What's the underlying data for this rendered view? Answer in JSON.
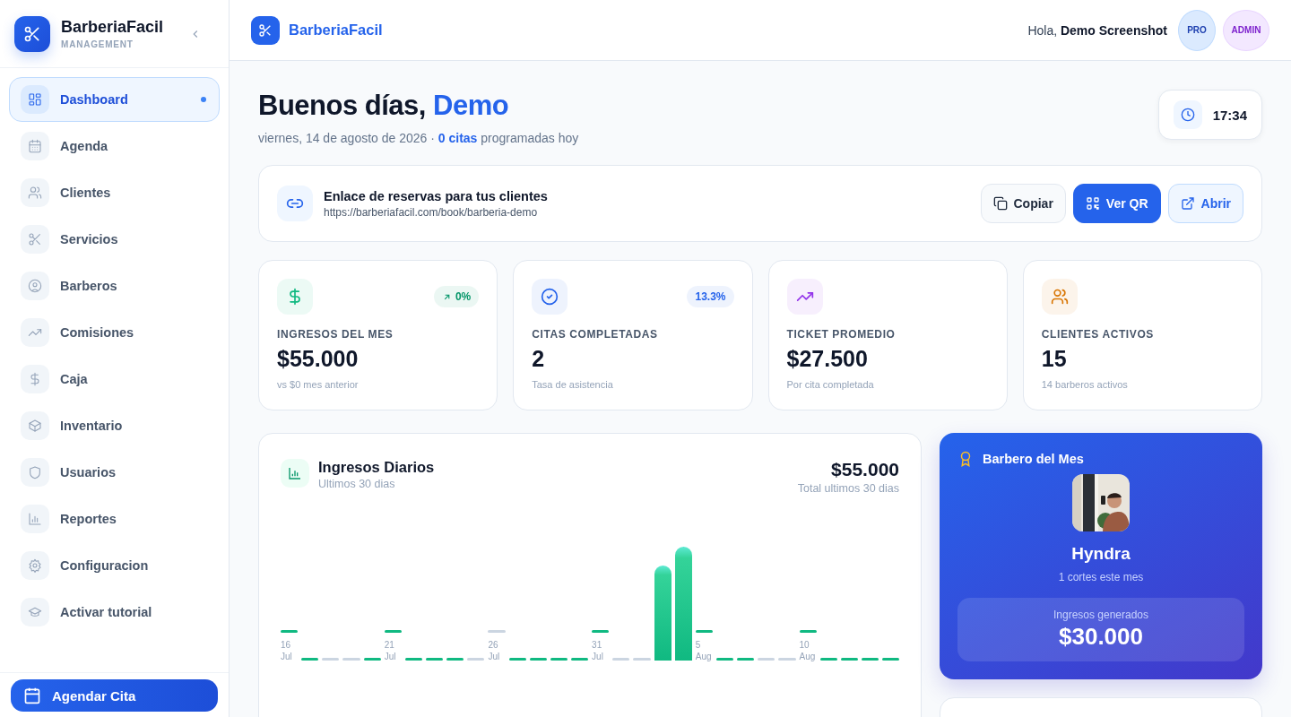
{
  "sidebar": {
    "brand": "BarberiaFacil",
    "subtitle": "MANAGEMENT",
    "items": [
      {
        "label": "Dashboard",
        "kind": "grid",
        "selected": true
      },
      {
        "label": "Agenda",
        "kind": "calendar",
        "selected": false
      },
      {
        "label": "Clientes",
        "kind": "users",
        "selected": false
      },
      {
        "label": "Servicios",
        "kind": "scissors",
        "selected": false
      },
      {
        "label": "Barberos",
        "kind": "user-circle",
        "selected": false
      },
      {
        "label": "Comisiones",
        "kind": "trend",
        "selected": false
      },
      {
        "label": "Caja",
        "kind": "dollar",
        "selected": false
      },
      {
        "label": "Inventario",
        "kind": "box",
        "selected": false
      },
      {
        "label": "Usuarios",
        "kind": "shield",
        "selected": false
      },
      {
        "label": "Reportes",
        "kind": "chart",
        "selected": false
      },
      {
        "label": "Configuracion",
        "kind": "gear",
        "selected": false
      },
      {
        "label": "Activar tutorial",
        "kind": "cap",
        "selected": false
      }
    ],
    "action": "Agendar Cita"
  },
  "header": {
    "brand": "BarberiaFacil",
    "greeting": "Hola, **Demo Screenshot**",
    "badges": [
      {
        "text": "PRO",
        "color": "#1e40af"
      },
      {
        "text": "ADMIN",
        "color": "#7e22ce"
      }
    ]
  },
  "welcome": {
    "title": "Buenos días,",
    "name": "Demo",
    "subtitle": "viernes, 14 de agosto de 2026 · **0 citas** programadas hoy",
    "time": "17:34"
  },
  "booking_link": {
    "title": "Enlace de reservas para tus clientes",
    "url": "https://barberiafacil.com/book/barberia-demo",
    "buttons": [
      {
        "label": "Copiar",
        "kind": "copy"
      },
      {
        "label": "Ver QR",
        "kind": "qr"
      },
      {
        "label": "Abrir",
        "kind": "open"
      }
    ]
  },
  "stats": [
    {
      "label": "INGRESOS DEL MES",
      "value": "$55.000",
      "note": "vs $0 mes anterior",
      "kind": "dollar",
      "color": "#10b981",
      "badge": {
        "text": "0%",
        "rising": true,
        "color": "#059669"
      }
    },
    {
      "label": "CITAS COMPLETADAS",
      "value": "2",
      "note": "Tasa de asistencia",
      "kind": "check",
      "color": "#2563eb",
      "badge": {
        "text": "13.3%",
        "rising": false,
        "color": "#2563eb"
      }
    },
    {
      "label": "TICKET PROMEDIO",
      "value": "$27.500",
      "note": "Por cita completada",
      "kind": "trend",
      "color": "#9333ea"
    },
    {
      "label": "CLIENTES ACTIVOS",
      "value": "15",
      "note": "14 barberos activos",
      "kind": "users",
      "color": "#d97706"
    }
  ],
  "daily_income": {
    "title": "Ingresos Diarios",
    "subtitle": "Ultimos 30 dias",
    "total": "$55.000",
    "total_label": "Total ultimos 30 dias",
    "date_labels": [
      {
        "day": "16",
        "month": "Jul"
      },
      {
        "day": "21",
        "month": "Jul"
      },
      {
        "day": "26",
        "month": "Jul"
      },
      {
        "day": "31",
        "month": "Jul"
      },
      {
        "day": "5",
        "month": "Aug"
      },
      {
        "day": "10",
        "month": "Aug"
      }
    ]
  },
  "barber_of_month": {
    "title": "Barbero del Mes",
    "name": "Hyndra",
    "note": "1 cortes este mes",
    "income_label": "Ingresos generados",
    "income": "$30.000"
  }
}
